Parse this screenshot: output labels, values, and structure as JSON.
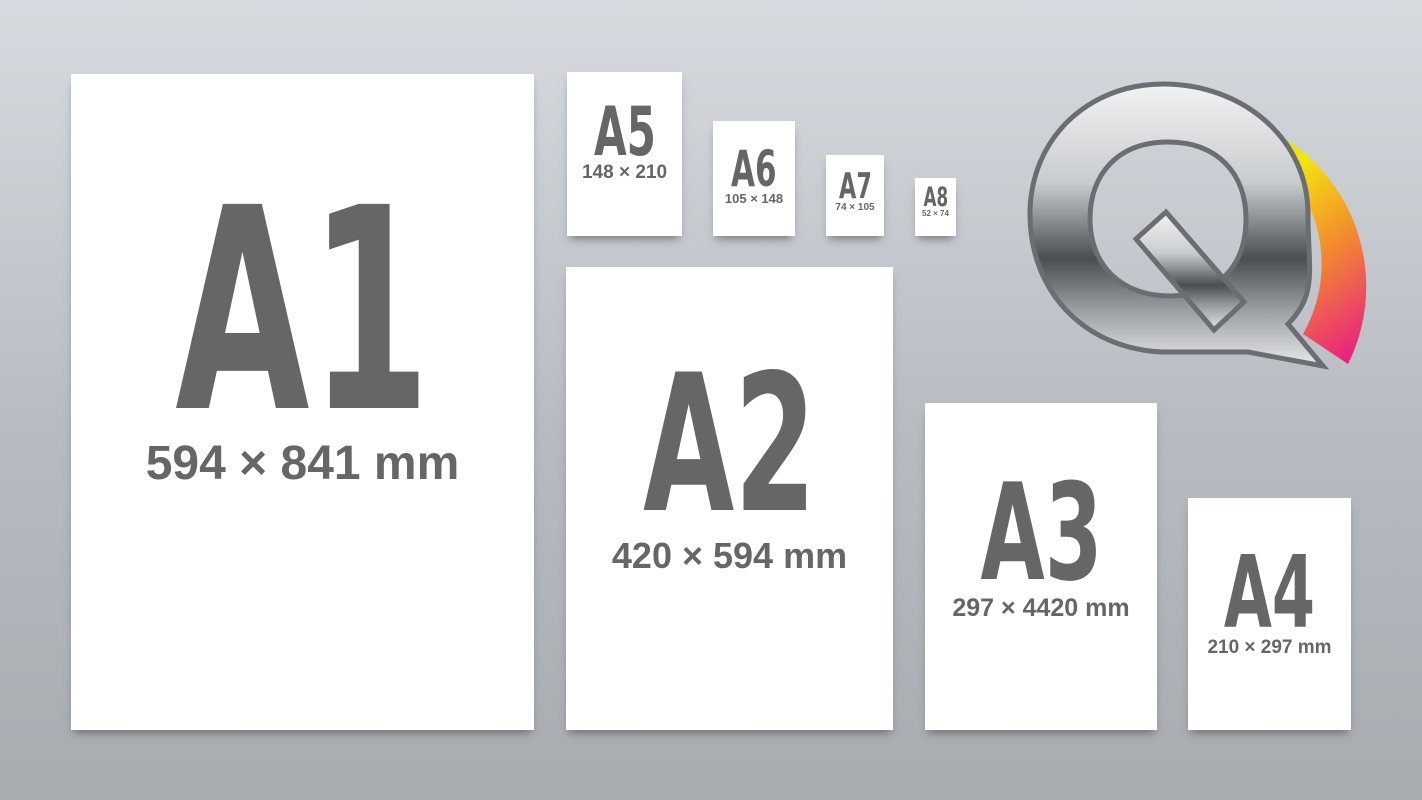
{
  "sheets": {
    "a1": {
      "code": "A1",
      "dims": "594 × 841 mm"
    },
    "a2": {
      "code": "A2",
      "dims": "420 × 594 mm"
    },
    "a3": {
      "code": "A3",
      "dims": "297 × 4420 mm"
    },
    "a4": {
      "code": "A4",
      "dims": "210 × 297 mm"
    },
    "a5": {
      "code": "A5",
      "dims": "148 × 210"
    },
    "a6": {
      "code": "A6",
      "dims": "105 × 148"
    },
    "a7": {
      "code": "A7",
      "dims": "74 × 105"
    },
    "a8": {
      "code": "A8",
      "dims": "52 × 74"
    }
  },
  "logo": {
    "icon": "q-logo-icon",
    "ring_colors": [
      "#1aa8e8",
      "#8fd14f",
      "#f5e60f",
      "#f28a2e",
      "#e8128c"
    ],
    "metal_colors": [
      "#f2f2f2",
      "#9a9ea3",
      "#4a4e52"
    ]
  },
  "colors": {
    "text": "#666666",
    "paper": "#ffffff",
    "background_top": "#d7dbe0",
    "background_bottom": "#a8abb0"
  }
}
